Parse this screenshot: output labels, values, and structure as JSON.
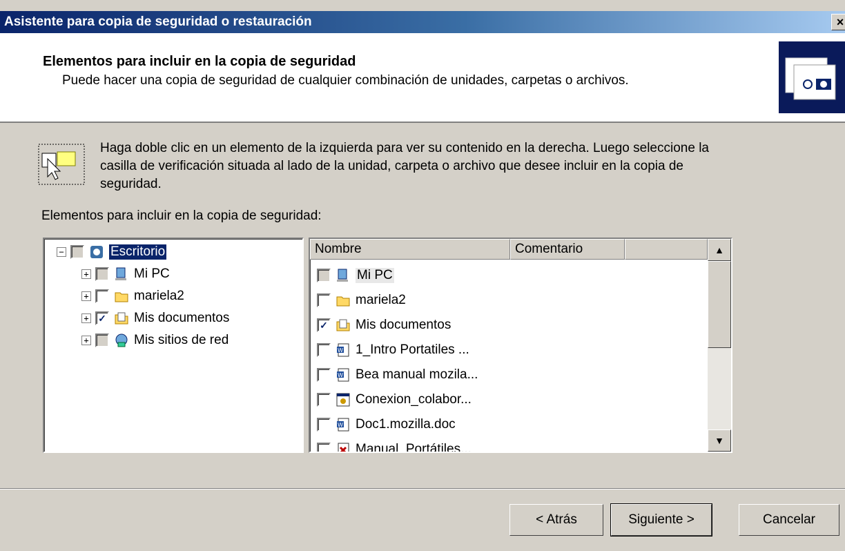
{
  "window": {
    "title": "Asistente para copia de seguridad o restauración",
    "close_label": "×"
  },
  "header": {
    "title": "Elementos para incluir en la copia de seguridad",
    "subtitle": "Puede hacer una copia de seguridad de cualquier combinación de unidades, carpetas o archivos."
  },
  "hint": "Haga doble clic en un elemento de la izquierda para ver su contenido en la derecha. Luego seleccione la casilla de verificación situada al lado de la unidad, carpeta o archivo que desee incluir en la copia de seguridad.",
  "list_label": "Elementos para incluir en la copia de seguridad:",
  "tree": {
    "root": {
      "label": "Escritorio",
      "expander": "−"
    },
    "items": [
      {
        "label": "Mi PC",
        "expander": "+",
        "check": "gray",
        "icon": "computer-icon"
      },
      {
        "label": "mariela2",
        "expander": "+",
        "check": "off",
        "icon": "folder-icon"
      },
      {
        "label": "Mis documentos",
        "expander": "+",
        "check": "on",
        "icon": "documents-folder-icon"
      },
      {
        "label": "Mis sitios de red",
        "expander": "+",
        "check": "gray",
        "icon": "network-icon"
      }
    ]
  },
  "list": {
    "columns": [
      "Nombre",
      "Comentario"
    ],
    "rows": [
      {
        "label": "Mi PC",
        "check": "gray",
        "icon": "computer-icon"
      },
      {
        "label": "mariela2",
        "check": "off",
        "icon": "folder-icon"
      },
      {
        "label": "Mis documentos",
        "check": "on",
        "icon": "documents-folder-icon"
      },
      {
        "label": "1_Intro Portatiles ...",
        "check": "off",
        "icon": "word-doc-icon"
      },
      {
        "label": "Bea manual mozila...",
        "check": "off",
        "icon": "word-doc-icon"
      },
      {
        "label": "Conexion_colabor...",
        "check": "off",
        "icon": "shortcut-icon"
      },
      {
        "label": "Doc1.mozilla.doc",
        "check": "off",
        "icon": "word-doc-icon"
      },
      {
        "label": "Manual_Portátiles...",
        "check": "off",
        "icon": "pdf-icon"
      }
    ],
    "scroll_up": "▲",
    "scroll_down": "▼"
  },
  "buttons": {
    "back": "< Atrás",
    "next": "Siguiente >",
    "cancel": "Cancelar"
  }
}
